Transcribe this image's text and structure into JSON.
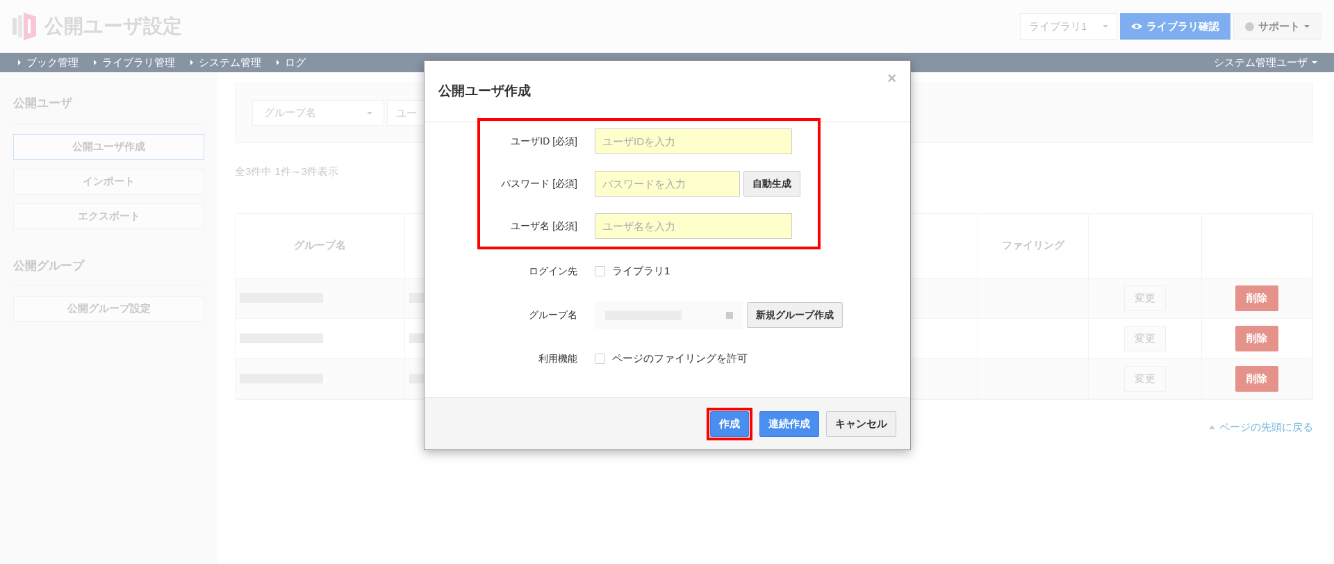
{
  "header": {
    "title": "公開ユーザ設定",
    "library_select": "ライブラリ1",
    "view_button": "ライブラリ確認",
    "support_menu": "サポート"
  },
  "nav": {
    "items": [
      "ブック管理",
      "ライブラリ管理",
      "システム管理",
      "ログ"
    ],
    "user_menu": "システム管理ユーザ"
  },
  "sidebar": [
    {
      "title": "公開ユーザ",
      "items": [
        {
          "label": "公開ユーザ作成",
          "selected": true
        },
        {
          "label": "インポート",
          "selected": false
        },
        {
          "label": "エクスポート",
          "selected": false
        }
      ]
    },
    {
      "title": "公開グループ",
      "items": [
        {
          "label": "公開グループ設定",
          "selected": false
        }
      ]
    }
  ],
  "filter": {
    "group_placeholder": "グループ名",
    "user_placeholder": "ユー"
  },
  "count": "全3件中 1件～3件表示",
  "table": {
    "columns": [
      {
        "label": "グループ名"
      },
      {
        "label": "ファイリング"
      }
    ],
    "rows": [
      {
        "edit": "変更",
        "delete": "削除"
      },
      {
        "edit": "変更",
        "delete": "削除"
      },
      {
        "edit": "変更",
        "delete": "削除"
      }
    ]
  },
  "back_to_top": "ページの先頭に戻る",
  "modal": {
    "title": "公開ユーザ作成",
    "close": "×",
    "fields": [
      {
        "kind": "text",
        "label": "ユーザID [必須]",
        "placeholder": "ユーザIDを入力",
        "highlighted": true
      },
      {
        "kind": "text",
        "label": "パスワード [必須]",
        "placeholder": "パスワードを入力",
        "button": "自動生成",
        "highlighted": true
      },
      {
        "kind": "text",
        "label": "ユーザ名 [必須]",
        "placeholder": "ユーザ名を入力",
        "highlighted": true
      },
      {
        "kind": "checkbox",
        "label": "ログイン先",
        "option": "ライブラリ1",
        "checked": false,
        "highlighted": false
      },
      {
        "kind": "select",
        "label": "グループ名",
        "button": "新規グループ作成",
        "highlighted": false
      },
      {
        "kind": "checkbox",
        "label": "利用機能",
        "option": "ページのファイリングを許可",
        "checked": false,
        "highlighted": false
      }
    ],
    "buttons": [
      {
        "label": "作成",
        "kind": "primary",
        "highlighted": true
      },
      {
        "label": "連続作成",
        "kind": "primary",
        "highlighted": false
      },
      {
        "label": "キャンセル",
        "kind": "default",
        "highlighted": false
      }
    ]
  }
}
